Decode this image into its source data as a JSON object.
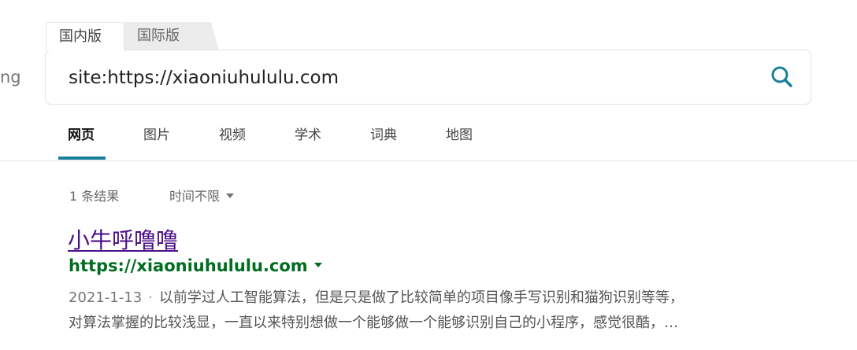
{
  "logo_fragment": "ng",
  "scope_tabs": {
    "domestic": "国内版",
    "international": "国际版"
  },
  "search": {
    "value": "site:https://xiaoniuhululu.com",
    "icon": "search-icon",
    "icon_color": "#1a7f9b"
  },
  "nav": {
    "items": [
      {
        "label": "网页",
        "active": true
      },
      {
        "label": "图片"
      },
      {
        "label": "视频"
      },
      {
        "label": "学术"
      },
      {
        "label": "词典"
      },
      {
        "label": "地图"
      }
    ],
    "accent": "#1a7f9b"
  },
  "filters": {
    "result_count": "1 条结果",
    "time_filter": "时间不限"
  },
  "result": {
    "title": "小牛呼噜噜",
    "url": "https://xiaoniuhululu.com",
    "date": "2021-1-13",
    "separator": "·",
    "snippet_line1": "以前学过人工智能算法，但是只是做了比较简单的项目像手写识别和猫狗识别等等，",
    "snippet_line2": "对算法掌握的比较浅显，一直以来特别想做一个能够做一个能够识别自己的小程序，感觉很酷，…",
    "title_color": "#4b0e8a",
    "url_color": "#006d21"
  }
}
